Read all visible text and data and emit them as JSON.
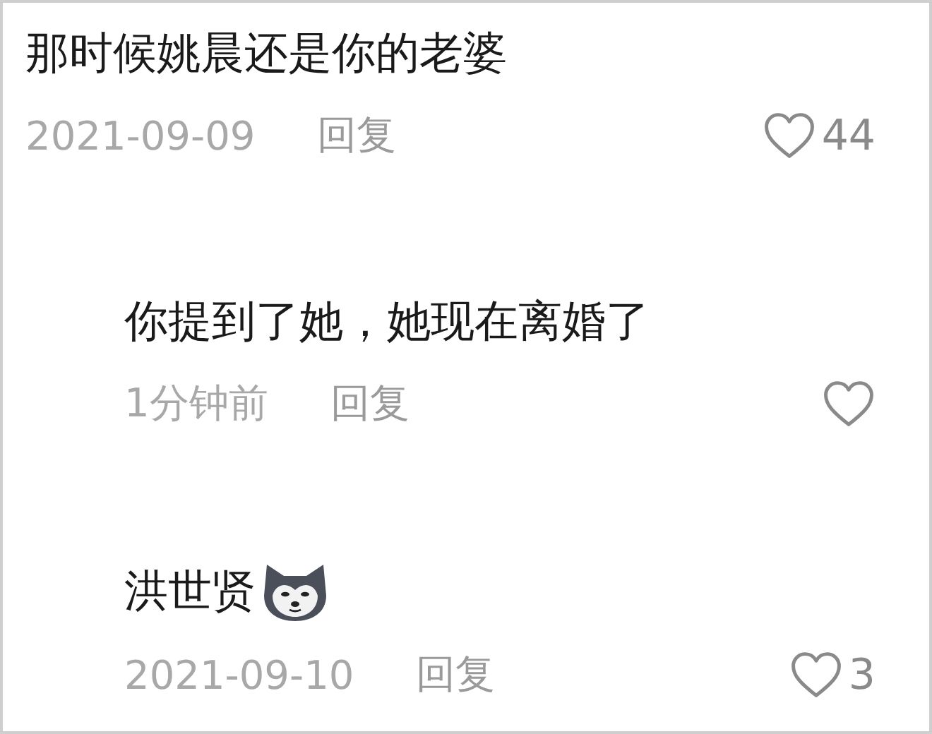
{
  "comments": [
    {
      "text": "那时候姚晨还是你的老婆",
      "date": "2021-09-09",
      "reply_label": "回复",
      "likes": "44",
      "children": [
        {
          "text": "你提到了她，她现在离婚了",
          "date": "1分钟前",
          "reply_label": "回复"
        },
        {
          "text": "洪世贤",
          "emoji": true,
          "date": "2021-09-10",
          "reply_label": "回复",
          "likes": "3"
        }
      ]
    }
  ]
}
